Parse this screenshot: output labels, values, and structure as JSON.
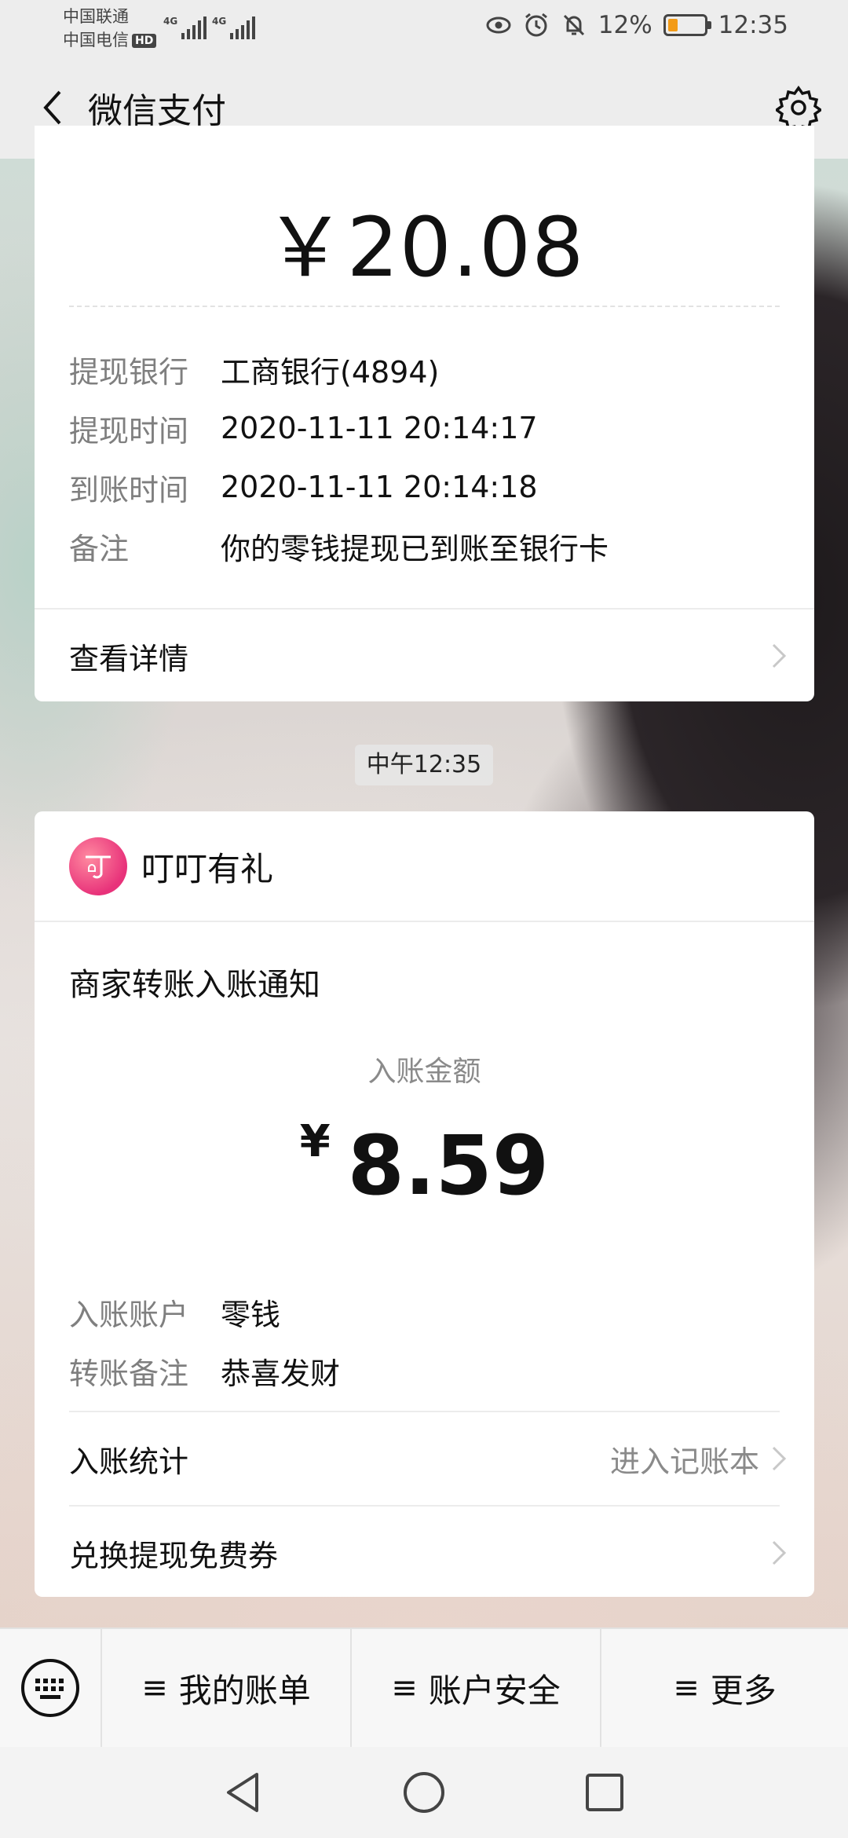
{
  "status_bar": {
    "carrier1": "中国联通",
    "carrier2": "中国电信",
    "hd": "HD",
    "net1": "4G",
    "net2": "4G",
    "battery_percent": "12%",
    "battery_level": 0.12,
    "time": "12:35",
    "icons": [
      "eye-icon",
      "alarm-icon",
      "mute-icon",
      "battery-icon"
    ]
  },
  "header": {
    "title": "微信支付",
    "back_icon": "chevron-left-icon",
    "settings_icon": "gear-icon"
  },
  "withdraw_card": {
    "amount": "￥20.08",
    "rows": [
      {
        "key": "提现银行",
        "value": "工商银行(4894)"
      },
      {
        "key": "提现时间",
        "value": "2020-11-11 20:14:17"
      },
      {
        "key": "到账时间",
        "value": "2020-11-11 20:14:18"
      },
      {
        "key": "备注",
        "value": "你的零钱提现已到账至银行卡"
      }
    ],
    "detail_link": "查看详情"
  },
  "timestamp": "中午12:35",
  "transfer_card": {
    "brand_name": "叮叮有礼",
    "title": "商家转账入账通知",
    "amount_label": "入账金额",
    "currency": "¥",
    "amount": "8.59",
    "rows": [
      {
        "key": "入账账户",
        "value": "零钱"
      },
      {
        "key": "转账备注",
        "value": "恭喜发财"
      }
    ],
    "stats_label": "入账统计",
    "stats_hint": "进入记账本",
    "coupon_label": "兑换提现免费券"
  },
  "menu": {
    "keyboard_icon": "keyboard-icon",
    "items": [
      {
        "icon": "≡",
        "label": "我的账单"
      },
      {
        "icon": "≡",
        "label": "账户安全"
      },
      {
        "icon": "≡",
        "label": "更多"
      }
    ]
  },
  "colors": {
    "page_bg": "#ededed",
    "card_bg": "#ffffff",
    "muted_text": "#7f7f7f",
    "battery_fill": "#f39b17",
    "brand_logo": "#e8327a"
  }
}
